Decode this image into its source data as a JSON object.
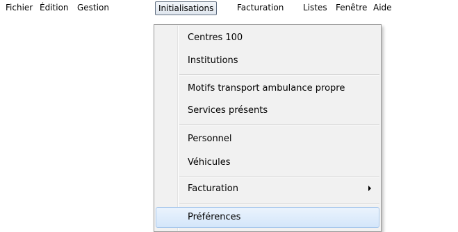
{
  "menubar": {
    "items": [
      "Fichier",
      "Édition",
      "Gestion",
      "Initialisations",
      "Facturation",
      "Listes",
      "Fenêtre",
      "Aide"
    ],
    "active": "Initialisations"
  },
  "dropdown": {
    "items": [
      {
        "label": "Centres 100"
      },
      {
        "label": "Institutions"
      },
      {
        "label": "Motifs transport ambulance propre"
      },
      {
        "label": "Services présents"
      },
      {
        "label": "Personnel"
      },
      {
        "label": "Véhicules"
      },
      {
        "label": "Facturation",
        "submenu": true
      },
      {
        "label": "Préférences",
        "highlighted": true
      }
    ]
  }
}
